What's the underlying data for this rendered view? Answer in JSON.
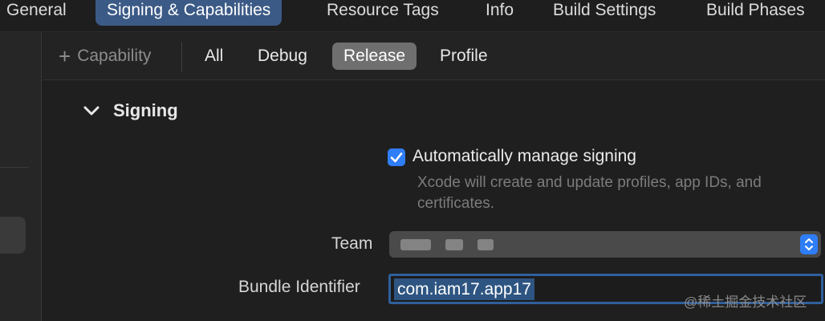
{
  "top_tabs": [
    "General",
    "Signing & Capabilities",
    "Resource Tags",
    "Info",
    "Build Settings",
    "Build Phases"
  ],
  "active_top_tab": "Signing & Capabilities",
  "filter_bar": {
    "capability_label": "Capability",
    "segments": [
      "All",
      "Debug",
      "Release",
      "Profile"
    ],
    "active_segment": "Release"
  },
  "signing": {
    "section_title": "Signing",
    "auto_manage": {
      "checked": true,
      "label": "Automatically manage signing",
      "hint": "Xcode will create and update profiles, app IDs, and certificates."
    },
    "team": {
      "label": "Team",
      "value": ""
    },
    "bundle_identifier": {
      "label": "Bundle Identifier",
      "value": "com.iam17.app17"
    }
  },
  "watermark": "@稀土掘金技术社区",
  "colors": {
    "accent": "#2f7ef7",
    "active_tab": "#3b5a86",
    "segment_active": "#6f6f6f"
  }
}
